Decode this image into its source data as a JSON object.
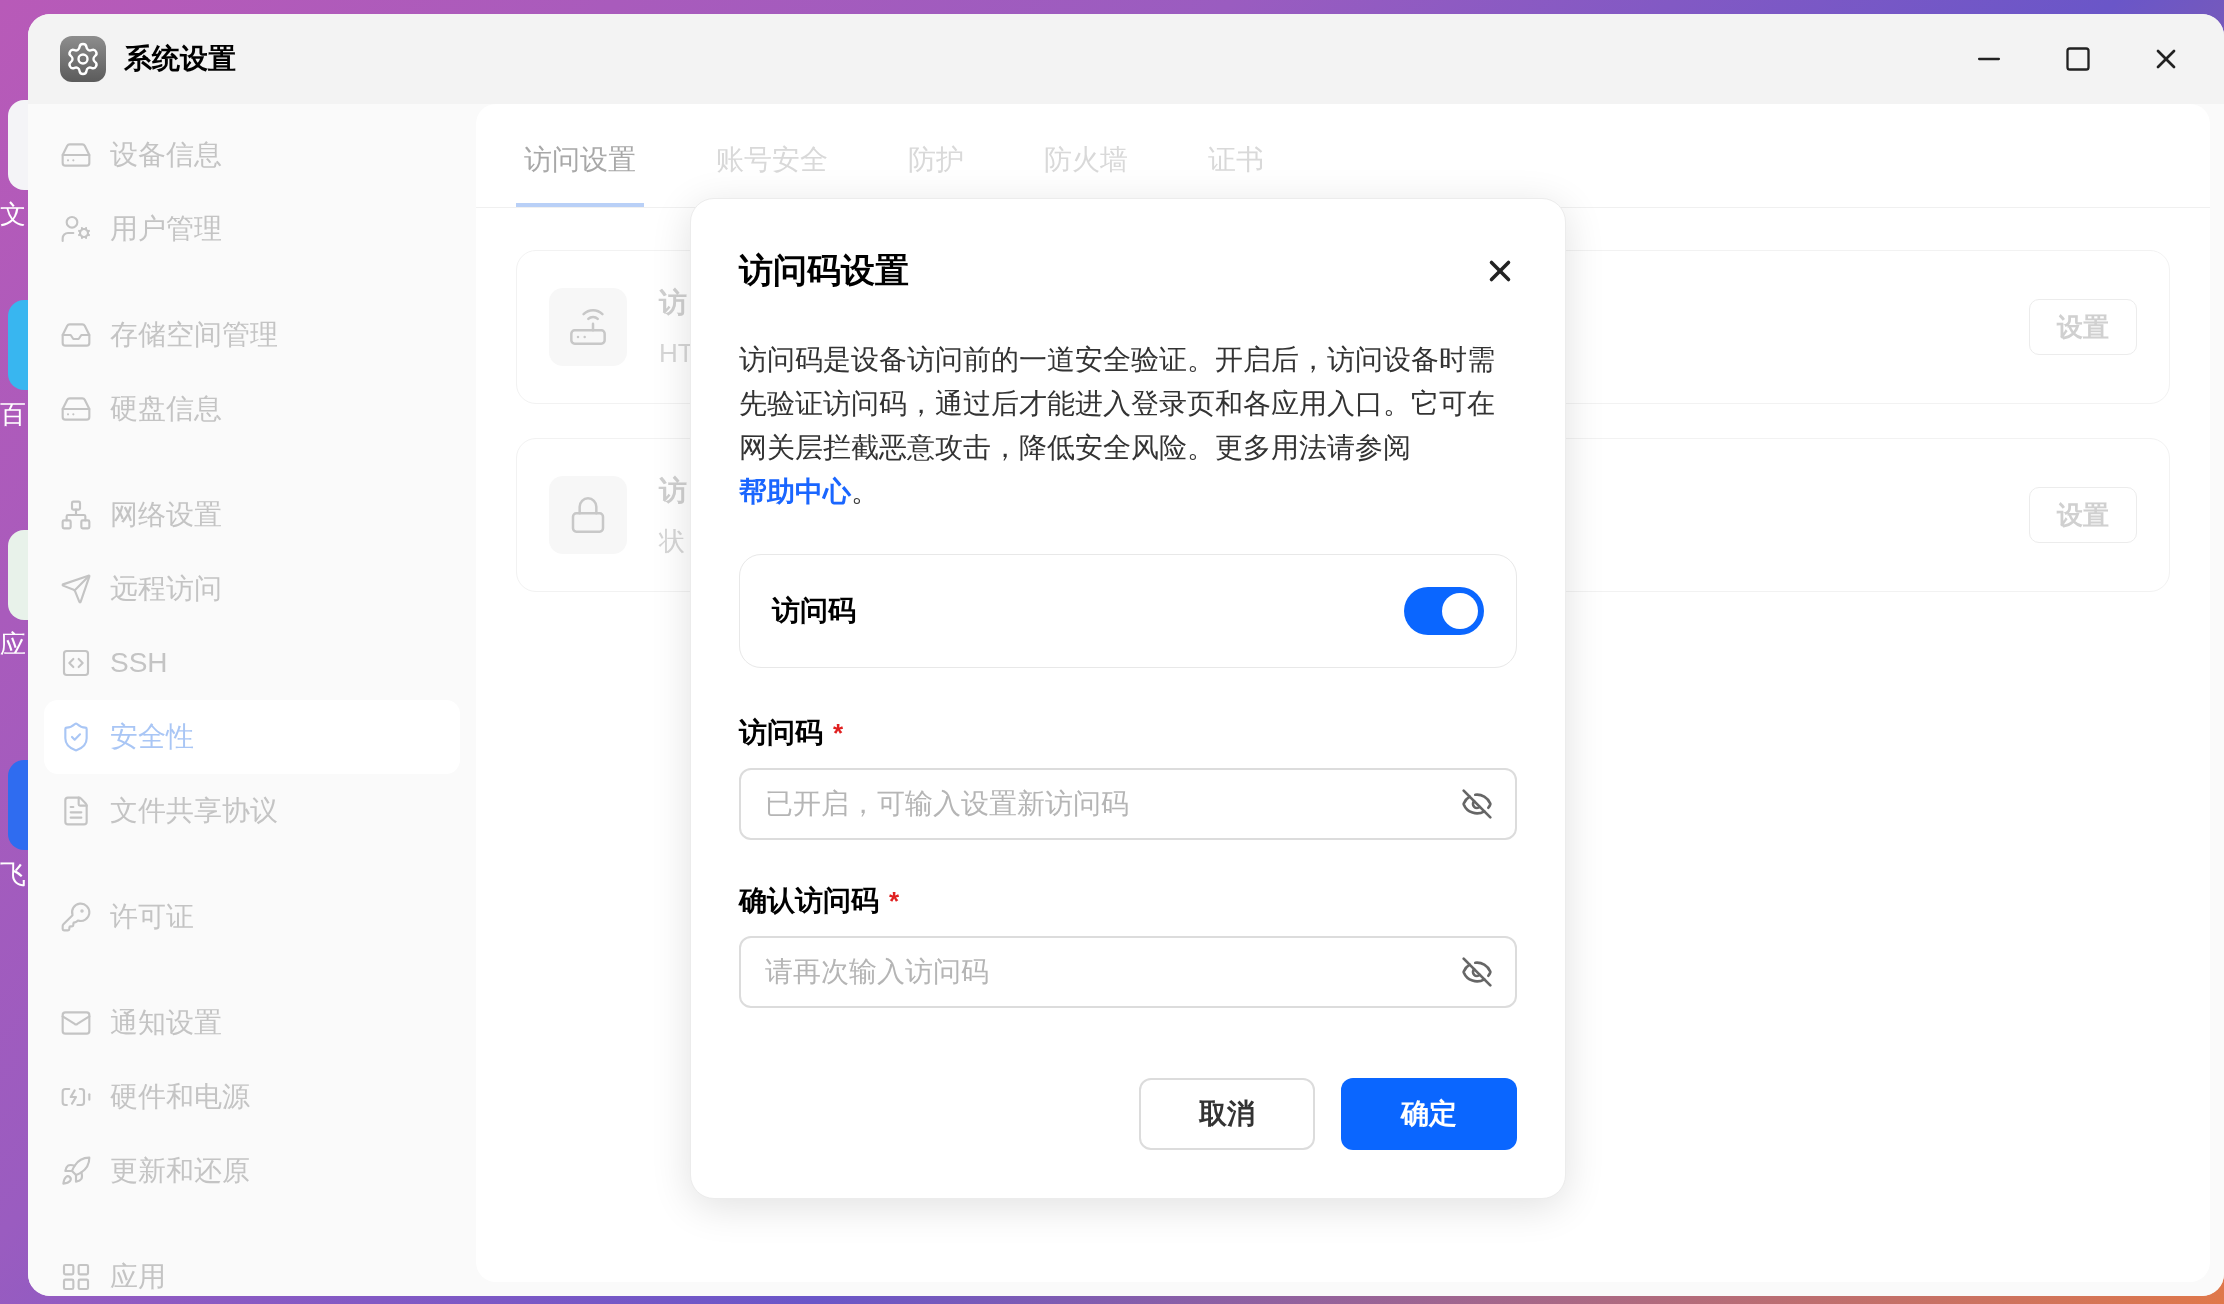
{
  "desktop_labels": [
    "文",
    "百",
    "应",
    "飞"
  ],
  "window": {
    "title": "系统设置"
  },
  "sidebar": {
    "groups": [
      {
        "items": [
          {
            "label": "设备信息",
            "selected": false
          },
          {
            "label": "用户管理",
            "selected": false
          }
        ]
      },
      {
        "items": [
          {
            "label": "存储空间管理",
            "selected": false
          },
          {
            "label": "硬盘信息",
            "selected": false
          }
        ]
      },
      {
        "items": [
          {
            "label": "网络设置",
            "selected": false
          },
          {
            "label": "远程访问",
            "selected": false
          },
          {
            "label": "SSH",
            "selected": false
          },
          {
            "label": "安全性",
            "selected": true
          },
          {
            "label": "文件共享协议",
            "selected": false
          }
        ]
      },
      {
        "items": [
          {
            "label": "许可证",
            "selected": false
          }
        ]
      },
      {
        "items": [
          {
            "label": "通知设置",
            "selected": false
          },
          {
            "label": "硬件和电源",
            "selected": false
          },
          {
            "label": "更新和还原",
            "selected": false
          }
        ]
      },
      {
        "items": [
          {
            "label": "应用",
            "selected": false
          }
        ]
      }
    ]
  },
  "tabs": [
    {
      "label": "访问设置",
      "selected": true
    },
    {
      "label": "账号安全",
      "selected": false
    },
    {
      "label": "防护",
      "selected": false
    },
    {
      "label": "防火墙",
      "selected": false
    },
    {
      "label": "证书",
      "selected": false
    }
  ],
  "cards": [
    {
      "title": "访",
      "subtitle": "HT",
      "button": "设置"
    },
    {
      "title": "访",
      "subtitle": "状",
      "button": "设置"
    }
  ],
  "dialog": {
    "title": "访问码设置",
    "description": "访问码是设备访问前的一道安全验证。开启后，访问设备时需先验证访问码，通过后才能进入登录页和各应用入口。它可在网关层拦截恶意攻击，降低安全风险。更多用法请参阅",
    "link": "帮助中心",
    "description_end": "。",
    "toggle": {
      "label": "访问码",
      "on": true
    },
    "fields": [
      {
        "label": "访问码",
        "required_mark": "*",
        "placeholder": "已开启，可输入设置新访问码"
      },
      {
        "label": "确认访问码",
        "required_mark": "*",
        "placeholder": "请再次输入访问码"
      }
    ],
    "buttons": [
      {
        "label": "取消",
        "kind": "secondary"
      },
      {
        "label": "确定",
        "kind": "primary"
      }
    ]
  }
}
